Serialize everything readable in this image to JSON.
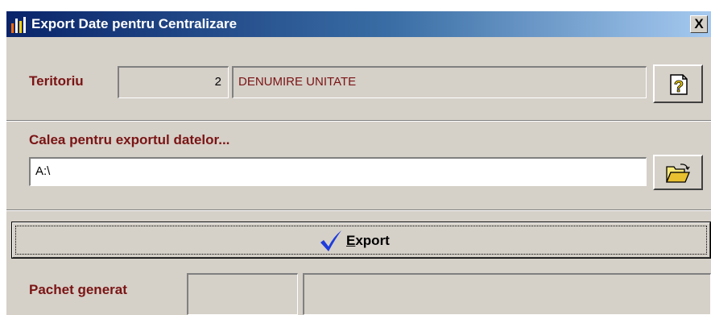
{
  "window": {
    "title": "Export Date pentru Centralizare",
    "close_label": "X"
  },
  "teritoriu": {
    "label": "Teritoriu",
    "code": "2",
    "name": "DENUMIRE UNITATE",
    "lookup_icon": "help-icon"
  },
  "export_path": {
    "label": "Calea pentru exportul datelor...",
    "value": "A:\\",
    "browse_icon": "open-folder-icon"
  },
  "export_button": {
    "icon": "checkmark-icon",
    "label_first": "E",
    "label_rest": "xport"
  },
  "pachet": {
    "label": "Pachet generat",
    "value_short": "",
    "value_long": ""
  },
  "colors": {
    "title_start": "#0a246a",
    "title_end": "#a6caf0",
    "label": "#7a1414",
    "face": "#d5d0c8",
    "check": "#1e3cdc"
  }
}
